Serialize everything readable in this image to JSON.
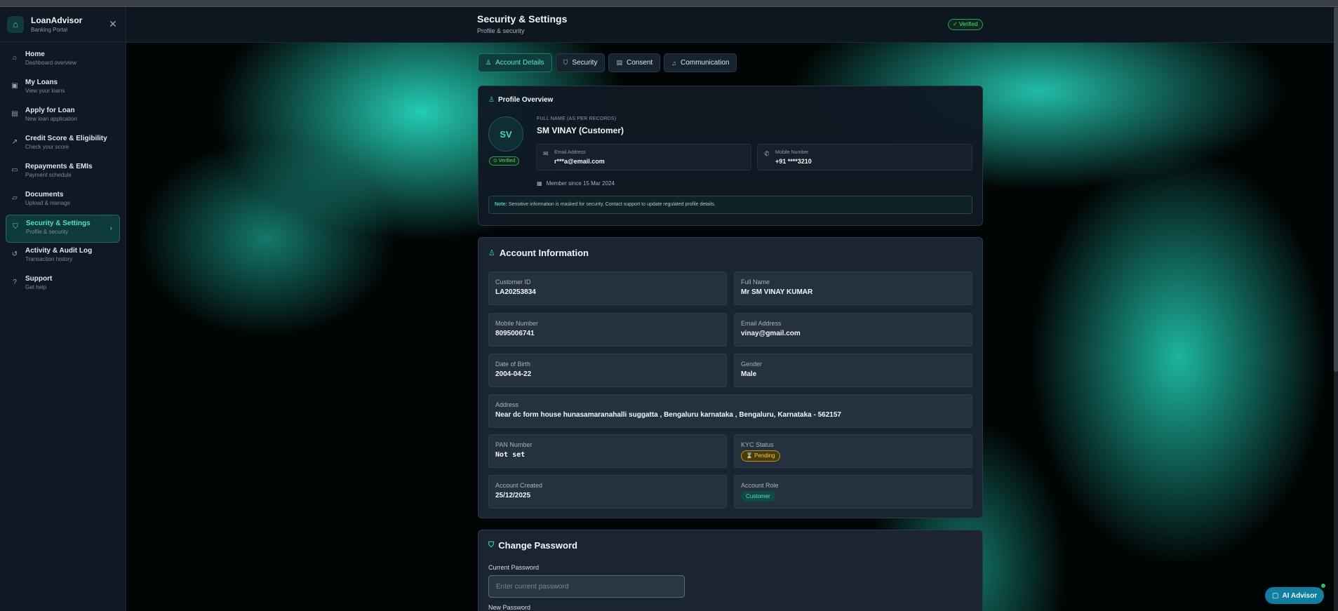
{
  "brand": {
    "title": "LoanAdvisor",
    "subtitle": "Banking Portal",
    "close_glyph": "✕"
  },
  "sidebar": {
    "items": [
      {
        "label": "Home",
        "sub": "Dashboard overview",
        "icon": "home-icon",
        "glyph": "⌂"
      },
      {
        "label": "My Loans",
        "sub": "View your loans",
        "icon": "wallet-icon",
        "glyph": "▣"
      },
      {
        "label": "Apply for Loan",
        "sub": "New loan application",
        "icon": "file-icon",
        "glyph": "▤"
      },
      {
        "label": "Credit Score & Eligibility",
        "sub": "Check your score",
        "icon": "trending-up-icon",
        "glyph": "↗"
      },
      {
        "label": "Repayments & EMIs",
        "sub": "Payment schedule",
        "icon": "credit-card-icon",
        "glyph": "▭"
      },
      {
        "label": "Documents",
        "sub": "Upload & manage",
        "icon": "folder-icon",
        "glyph": "▱"
      },
      {
        "label": "Security & Settings",
        "sub": "Profile & security",
        "icon": "shield-icon",
        "glyph": "⛉",
        "active": true
      },
      {
        "label": "Activity & Audit Log",
        "sub": "Transaction history",
        "icon": "history-icon",
        "glyph": "↺"
      },
      {
        "label": "Support",
        "sub": "Get help",
        "icon": "help-icon",
        "glyph": "?"
      }
    ],
    "active_chevron": "›"
  },
  "header": {
    "title": "Security & Settings",
    "subtitle": "Profile & security",
    "verified": "✓ Verified"
  },
  "tabs": [
    {
      "label": "Account Details",
      "glyph": "♙",
      "active": true
    },
    {
      "label": "Security",
      "glyph": "⛉"
    },
    {
      "label": "Consent",
      "glyph": "▤"
    },
    {
      "label": "Communication",
      "glyph": "♫"
    }
  ],
  "profile": {
    "heading": "Profile Overview",
    "initials": "SV",
    "verified_badge": "⊙ Verified",
    "full_name_label": "FULL NAME (AS PER RECORDS)",
    "full_name": "SM VINAY (Customer)",
    "email_label": "Email Address",
    "email_value": "r***a@email.com",
    "mobile_label": "Mobile Number",
    "mobile_value": "+91 ****3210",
    "member_since": "Member since 15 Mar 2024",
    "note_label": "Note:",
    "note_text": " Sensitive information is masked for security. Contact support to update regulated profile details."
  },
  "account": {
    "heading": "Account Information",
    "customer_id_label": "Customer ID",
    "customer_id": "LA20253834",
    "full_name_label": "Full Name",
    "full_name": "Mr SM VINAY KUMAR",
    "mobile_label": "Mobile Number",
    "mobile": "8095006741",
    "email_label": "Email Address",
    "email": "vinay@gmail.com",
    "dob_label": "Date of Birth",
    "dob": "2004-04-22",
    "gender_label": "Gender",
    "gender": "Male",
    "address_label": "Address",
    "address": "Near dc form house hunasamaranahalli suggatta , Bengaluru karnataka , Bengaluru, Karnataka - 562157",
    "pan_label": "PAN Number",
    "pan": "Not set",
    "kyc_label": "KYC Status",
    "kyc": "⌛ Pending",
    "created_label": "Account Created",
    "created": "25/12/2025",
    "role_label": "Account Role",
    "role": "Customer"
  },
  "password": {
    "heading": "Change Password",
    "current_label": "Current Password",
    "current_placeholder": "Enter current password",
    "new_label": "New Password"
  },
  "ai_button": {
    "label": "AI Advisor",
    "glyph": "▢"
  },
  "colors": {
    "accent": "#2dd4bf",
    "verified": "#4ade80",
    "pending": "#f2c94c",
    "ai_button": "#0e7fa0"
  }
}
